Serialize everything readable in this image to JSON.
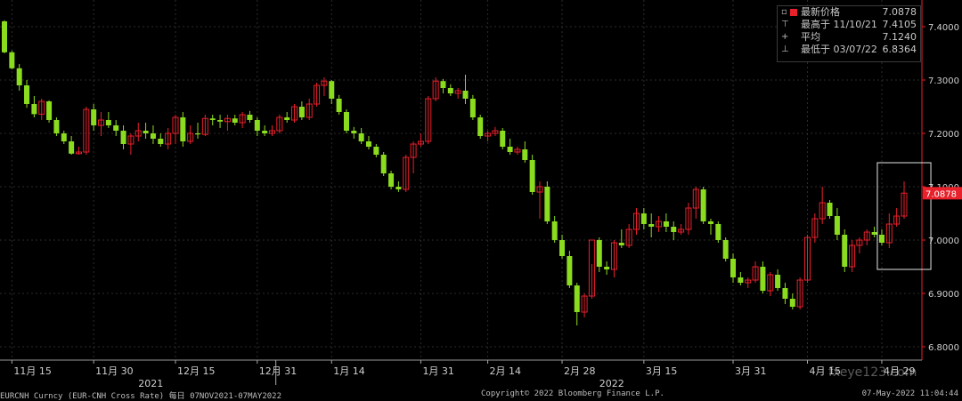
{
  "chart_data": {
    "type": "candlestick",
    "y_ticks": [
      "7.4000",
      "7.3000",
      "7.2000",
      "7.1000",
      "7.0000",
      "6.9000",
      "6.8000"
    ],
    "ylim": [
      6.775,
      7.45
    ],
    "x_tick_labels": [
      "11月 15",
      "11月 30",
      "12月 15",
      "12月 31",
      "1月 14",
      "1月 31",
      "2月 14",
      "2月 28",
      "3月 15",
      "3月 31",
      "4月 15",
      "4月 29"
    ],
    "x_tick_indices": [
      1,
      12,
      23,
      34,
      44,
      56,
      65,
      75,
      86,
      98,
      108,
      118
    ],
    "year_labels": [
      {
        "text": "2021",
        "index": 18
      },
      {
        "text": "2022",
        "index": 80
      }
    ],
    "year_divider_index": 36.5,
    "last_price_label": "7.0878",
    "last_price": 7.0878,
    "highlight_box": {
      "from_index": 118,
      "to_index": 124,
      "low": 6.945,
      "high": 7.145
    },
    "colors": {
      "up": "#e8212b",
      "down": "#8bdc1f",
      "axis": "#e8212b",
      "grid": "#2d2d2d",
      "box": "#e6e6e6"
    },
    "candles": [
      [
        7.41,
        7.412,
        7.35,
        7.352
      ],
      [
        7.352,
        7.355,
        7.32,
        7.322
      ],
      [
        7.322,
        7.33,
        7.28,
        7.29
      ],
      [
        7.29,
        7.3,
        7.248,
        7.255
      ],
      [
        7.255,
        7.27,
        7.23,
        7.236
      ],
      [
        7.236,
        7.265,
        7.225,
        7.26
      ],
      [
        7.26,
        7.262,
        7.22,
        7.225
      ],
      [
        7.225,
        7.23,
        7.195,
        7.2
      ],
      [
        7.2,
        7.205,
        7.18,
        7.185
      ],
      [
        7.185,
        7.195,
        7.16,
        7.162
      ],
      [
        7.162,
        7.175,
        7.16,
        7.165
      ],
      [
        7.165,
        7.25,
        7.16,
        7.245
      ],
      [
        7.245,
        7.255,
        7.205,
        7.215
      ],
      [
        7.215,
        7.24,
        7.195,
        7.225
      ],
      [
        7.225,
        7.24,
        7.21,
        7.215
      ],
      [
        7.215,
        7.225,
        7.195,
        7.205
      ],
      [
        7.205,
        7.215,
        7.17,
        7.18
      ],
      [
        7.18,
        7.2,
        7.16,
        7.195
      ],
      [
        7.195,
        7.22,
        7.185,
        7.205
      ],
      [
        7.205,
        7.22,
        7.19,
        7.2
      ],
      [
        7.2,
        7.215,
        7.18,
        7.19
      ],
      [
        7.19,
        7.2,
        7.175,
        7.18
      ],
      [
        7.18,
        7.21,
        7.17,
        7.2
      ],
      [
        7.2,
        7.235,
        7.18,
        7.23
      ],
      [
        7.23,
        7.24,
        7.175,
        7.185
      ],
      [
        7.185,
        7.215,
        7.18,
        7.2
      ],
      [
        7.2,
        7.22,
        7.19,
        7.198
      ],
      [
        7.198,
        7.235,
        7.195,
        7.228
      ],
      [
        7.228,
        7.235,
        7.215,
        7.225
      ],
      [
        7.225,
        7.235,
        7.21,
        7.222
      ],
      [
        7.222,
        7.235,
        7.205,
        7.228
      ],
      [
        7.228,
        7.235,
        7.215,
        7.22
      ],
      [
        7.22,
        7.24,
        7.21,
        7.235
      ],
      [
        7.235,
        7.242,
        7.22,
        7.225
      ],
      [
        7.225,
        7.23,
        7.195,
        7.205
      ],
      [
        7.205,
        7.215,
        7.195,
        7.2
      ],
      [
        7.2,
        7.215,
        7.195,
        7.205
      ],
      [
        7.205,
        7.235,
        7.2,
        7.23
      ],
      [
        7.23,
        7.24,
        7.22,
        7.225
      ],
      [
        7.225,
        7.255,
        7.22,
        7.25
      ],
      [
        7.25,
        7.26,
        7.225,
        7.23
      ],
      [
        7.23,
        7.265,
        7.225,
        7.255
      ],
      [
        7.255,
        7.295,
        7.25,
        7.29
      ],
      [
        7.29,
        7.305,
        7.27,
        7.298
      ],
      [
        7.298,
        7.3,
        7.255,
        7.265
      ],
      [
        7.265,
        7.272,
        7.235,
        7.24
      ],
      [
        7.24,
        7.245,
        7.2,
        7.205
      ],
      [
        7.205,
        7.212,
        7.19,
        7.2
      ],
      [
        7.2,
        7.21,
        7.18,
        7.185
      ],
      [
        7.185,
        7.195,
        7.17,
        7.175
      ],
      [
        7.175,
        7.18,
        7.155,
        7.16
      ],
      [
        7.16,
        7.165,
        7.12,
        7.125
      ],
      [
        7.125,
        7.13,
        7.095,
        7.1
      ],
      [
        7.1,
        7.11,
        7.09,
        7.095
      ],
      [
        7.095,
        7.16,
        7.09,
        7.155
      ],
      [
        7.155,
        7.185,
        7.125,
        7.18
      ],
      [
        7.18,
        7.2,
        7.175,
        7.185
      ],
      [
        7.185,
        7.27,
        7.18,
        7.265
      ],
      [
        7.265,
        7.305,
        7.26,
        7.298
      ],
      [
        7.298,
        7.302,
        7.275,
        7.285
      ],
      [
        7.285,
        7.292,
        7.27,
        7.275
      ],
      [
        7.275,
        7.285,
        7.265,
        7.28
      ],
      [
        7.28,
        7.31,
        7.255,
        7.265
      ],
      [
        7.265,
        7.272,
        7.225,
        7.23
      ],
      [
        7.23,
        7.235,
        7.19,
        7.195
      ],
      [
        7.195,
        7.205,
        7.185,
        7.2
      ],
      [
        7.2,
        7.212,
        7.195,
        7.205
      ],
      [
        7.205,
        7.21,
        7.17,
        7.175
      ],
      [
        7.175,
        7.19,
        7.16,
        7.165
      ],
      [
        7.165,
        7.175,
        7.16,
        7.17
      ],
      [
        7.17,
        7.185,
        7.145,
        7.15
      ],
      [
        7.15,
        7.16,
        7.085,
        7.09
      ],
      [
        7.09,
        7.11,
        7.04,
        7.1
      ],
      [
        7.1,
        7.11,
        7.03,
        7.035
      ],
      [
        7.035,
        7.045,
        6.995,
        7.0
      ],
      [
        7.0,
        7.01,
        6.965,
        6.97
      ],
      [
        6.97,
        6.98,
        6.91,
        6.915
      ],
      [
        6.915,
        6.92,
        6.84,
        6.865
      ],
      [
        6.865,
        6.9,
        6.855,
        6.895
      ],
      [
        6.895,
        6.955,
        6.89,
        7.0
      ],
      [
        7.0,
        7.005,
        6.94,
        6.95
      ],
      [
        6.95,
        6.96,
        6.935,
        6.945
      ],
      [
        6.945,
        7.0,
        6.93,
        6.995
      ],
      [
        6.995,
        7.02,
        6.985,
        6.99
      ],
      [
        6.99,
        7.03,
        6.985,
        7.02
      ],
      [
        7.02,
        7.06,
        7.01,
        7.05
      ],
      [
        7.05,
        7.06,
        7.02,
        7.03
      ],
      [
        7.03,
        7.05,
        7.005,
        7.025
      ],
      [
        7.025,
        7.045,
        7.015,
        7.035
      ],
      [
        7.035,
        7.05,
        7.015,
        7.025
      ],
      [
        7.025,
        7.035,
        7.0,
        7.015
      ],
      [
        7.015,
        7.03,
        7.01,
        7.02
      ],
      [
        7.02,
        7.07,
        7.01,
        7.06
      ],
      [
        7.06,
        7.1,
        7.04,
        7.095
      ],
      [
        7.095,
        7.1,
        7.03,
        7.035
      ],
      [
        7.035,
        7.04,
        7.01,
        7.03
      ],
      [
        7.03,
        7.035,
        6.995,
        7.0
      ],
      [
        7.0,
        7.005,
        6.96,
        6.965
      ],
      [
        6.965,
        6.975,
        6.92,
        6.93
      ],
      [
        6.93,
        6.94,
        6.915,
        6.92
      ],
      [
        6.92,
        6.93,
        6.91,
        6.925
      ],
      [
        6.925,
        6.96,
        6.92,
        6.95
      ],
      [
        6.95,
        6.96,
        6.9,
        6.905
      ],
      [
        6.905,
        6.94,
        6.895,
        6.935
      ],
      [
        6.935,
        6.945,
        6.905,
        6.91
      ],
      [
        6.91,
        6.92,
        6.88,
        6.89
      ],
      [
        6.89,
        6.9,
        6.87,
        6.875
      ],
      [
        6.875,
        6.93,
        6.87,
        6.925
      ],
      [
        6.925,
        7.01,
        6.92,
        7.005
      ],
      [
        7.005,
        7.05,
        6.995,
        7.04
      ],
      [
        7.04,
        7.1,
        7.03,
        7.07
      ],
      [
        7.07,
        7.075,
        7.04,
        7.045
      ],
      [
        7.045,
        7.06,
        7.0,
        7.01
      ],
      [
        7.01,
        7.02,
        6.94,
        6.95
      ],
      [
        6.95,
        7.0,
        6.94,
        6.99
      ],
      [
        6.99,
        7.005,
        6.975,
        7.0
      ],
      [
        7.0,
        7.02,
        6.99,
        7.015
      ],
      [
        7.015,
        7.025,
        7.005,
        7.01
      ],
      [
        7.01,
        7.02,
        6.99,
        6.995
      ],
      [
        6.995,
        7.05,
        6.985,
        7.03
      ],
      [
        7.03,
        7.06,
        7.025,
        7.045
      ],
      [
        7.045,
        7.11,
        7.04,
        7.088
      ]
    ]
  },
  "legend": {
    "last_label": "最新价格",
    "last_value": "7.0878",
    "high_label": "最高于 11/10/21",
    "high_value": "7.4105",
    "avg_label": "平均",
    "avg_value": "7.1240",
    "low_label": "最低于 03/07/22",
    "low_value": "6.8364"
  },
  "footer": {
    "left": "EURCNH Curncy (EUR-CNH Cross Rate)  每日 07NOV2021-07MAY2022",
    "center": "Copyright© 2022 Bloomberg Finance L.P.",
    "right": "07-May-2022 11:04:44"
  },
  "watermark": "fxeye123.com"
}
